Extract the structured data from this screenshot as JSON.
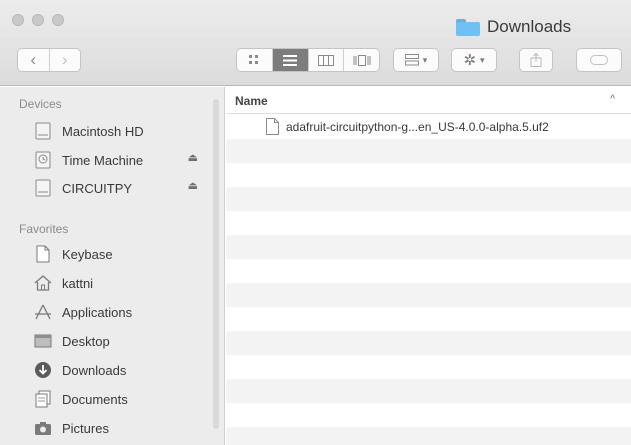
{
  "window": {
    "title": "Downloads",
    "title_icon": "folder-icon"
  },
  "toolbar": {
    "back": "‹",
    "forward": "›",
    "view_modes": [
      "icon-view",
      "list-view",
      "column-view",
      "cover-flow-view"
    ],
    "active_view": "list-view",
    "arrange_icon": "arrange-icon",
    "action_icon": "gear-icon",
    "share_icon": "share-icon",
    "tags_icon": "tag-icon"
  },
  "sidebar": {
    "devices_header": "Devices",
    "devices": [
      {
        "label": "Macintosh HD",
        "icon": "hard-drive-icon",
        "eject": false
      },
      {
        "label": "Time Machine",
        "icon": "time-machine-icon",
        "eject": true
      },
      {
        "label": "CIRCUITPY",
        "icon": "drive-icon",
        "eject": true
      }
    ],
    "favorites_header": "Favorites",
    "favorites": [
      {
        "label": "Keybase",
        "icon": "document-icon"
      },
      {
        "label": "kattni",
        "icon": "home-icon"
      },
      {
        "label": "Applications",
        "icon": "applications-icon"
      },
      {
        "label": "Desktop",
        "icon": "desktop-icon"
      },
      {
        "label": "Downloads",
        "icon": "downloads-icon"
      },
      {
        "label": "Documents",
        "icon": "documents-icon"
      },
      {
        "label": "Pictures",
        "icon": "camera-icon"
      }
    ],
    "eject_glyph": "⏏"
  },
  "list": {
    "column_name": "Name",
    "sort_glyph": "^",
    "files": [
      {
        "name": "adafruit-circuitpython-g...en_US-4.0.0-alpha.5.uf2",
        "icon": "file-icon"
      }
    ]
  },
  "colors": {
    "folder": "#6ec1f2",
    "sidebar_bg": "#ececec",
    "row_alt": "#f3f3f3"
  }
}
